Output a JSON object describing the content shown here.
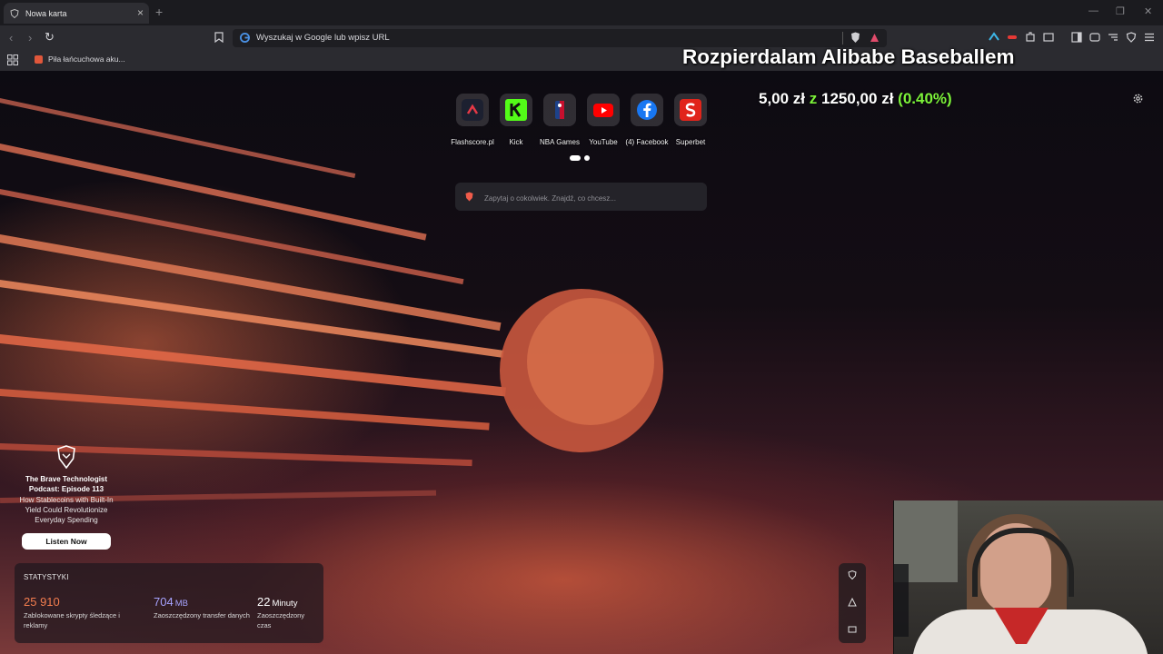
{
  "browser": {
    "tab_title": "Nowa karta",
    "new_tab_symbol": "+",
    "close_symbol": "×",
    "window_controls": [
      "—",
      "❐",
      "✕"
    ],
    "address_placeholder": "Wyszukaj w Google lub wpisz URL",
    "bookmark_item": "Piła łańcuchowa aku..."
  },
  "overlay": {
    "stream_title": "Rozpierdalam Alibabe Baseballem",
    "donation_amount": "5,00 zł",
    "donation_sep": "z",
    "donation_goal": "1250,00 zł",
    "donation_percent": "(0.40%)",
    "accent_color": "#7cf23a"
  },
  "top_sites": [
    {
      "label": "Flashscore.pl",
      "icon": "flashscore-icon"
    },
    {
      "label": "Kick",
      "icon": "kick-icon"
    },
    {
      "label": "NBA Games",
      "icon": "nba-icon"
    },
    {
      "label": "YouTube",
      "icon": "youtube-icon"
    },
    {
      "label": "(4) Facebook",
      "icon": "facebook-icon"
    },
    {
      "label": "Superbet",
      "icon": "superbet-icon"
    }
  ],
  "search": {
    "placeholder": "Zapytaj o cokolwiek. Znajdź, co chcesz..."
  },
  "sponsor": {
    "title": "The Brave Technologist Podcast: Episode 113",
    "description": "How Stablecoins with Built-In Yield Could Revolutionize Everyday Spending",
    "button": "Listen Now"
  },
  "stats": {
    "heading": "STATYSTYKI",
    "items": [
      {
        "value": "25 910",
        "unit": "",
        "caption": "Zablokowane skrypty śledzące i reklamy",
        "color": "#f47e4f"
      },
      {
        "value": "704",
        "unit": "MB",
        "caption": "Zaoszczędzony transfer danych",
        "color": "#a7a3ff"
      },
      {
        "value": "22",
        "unit": "Minuty",
        "caption": "Zaoszczędzony czas",
        "color": "#ffffff"
      }
    ]
  }
}
